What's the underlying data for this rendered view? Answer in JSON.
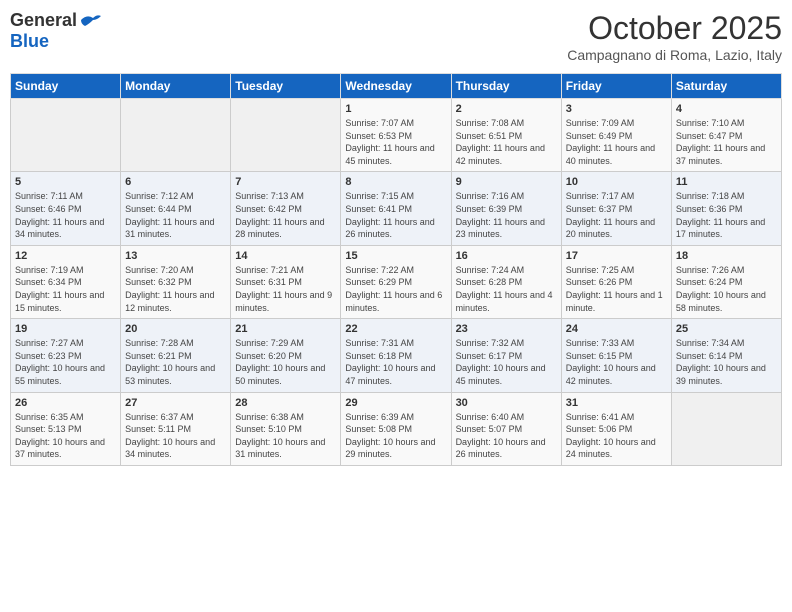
{
  "header": {
    "logo_general": "General",
    "logo_blue": "Blue",
    "month": "October 2025",
    "location": "Campagnano di Roma, Lazio, Italy"
  },
  "weekdays": [
    "Sunday",
    "Monday",
    "Tuesday",
    "Wednesday",
    "Thursday",
    "Friday",
    "Saturday"
  ],
  "weeks": [
    [
      {
        "day": "",
        "sunrise": "",
        "sunset": "",
        "daylight": ""
      },
      {
        "day": "",
        "sunrise": "",
        "sunset": "",
        "daylight": ""
      },
      {
        "day": "",
        "sunrise": "",
        "sunset": "",
        "daylight": ""
      },
      {
        "day": "1",
        "sunrise": "Sunrise: 7:07 AM",
        "sunset": "Sunset: 6:53 PM",
        "daylight": "Daylight: 11 hours and 45 minutes."
      },
      {
        "day": "2",
        "sunrise": "Sunrise: 7:08 AM",
        "sunset": "Sunset: 6:51 PM",
        "daylight": "Daylight: 11 hours and 42 minutes."
      },
      {
        "day": "3",
        "sunrise": "Sunrise: 7:09 AM",
        "sunset": "Sunset: 6:49 PM",
        "daylight": "Daylight: 11 hours and 40 minutes."
      },
      {
        "day": "4",
        "sunrise": "Sunrise: 7:10 AM",
        "sunset": "Sunset: 6:47 PM",
        "daylight": "Daylight: 11 hours and 37 minutes."
      }
    ],
    [
      {
        "day": "5",
        "sunrise": "Sunrise: 7:11 AM",
        "sunset": "Sunset: 6:46 PM",
        "daylight": "Daylight: 11 hours and 34 minutes."
      },
      {
        "day": "6",
        "sunrise": "Sunrise: 7:12 AM",
        "sunset": "Sunset: 6:44 PM",
        "daylight": "Daylight: 11 hours and 31 minutes."
      },
      {
        "day": "7",
        "sunrise": "Sunrise: 7:13 AM",
        "sunset": "Sunset: 6:42 PM",
        "daylight": "Daylight: 11 hours and 28 minutes."
      },
      {
        "day": "8",
        "sunrise": "Sunrise: 7:15 AM",
        "sunset": "Sunset: 6:41 PM",
        "daylight": "Daylight: 11 hours and 26 minutes."
      },
      {
        "day": "9",
        "sunrise": "Sunrise: 7:16 AM",
        "sunset": "Sunset: 6:39 PM",
        "daylight": "Daylight: 11 hours and 23 minutes."
      },
      {
        "day": "10",
        "sunrise": "Sunrise: 7:17 AM",
        "sunset": "Sunset: 6:37 PM",
        "daylight": "Daylight: 11 hours and 20 minutes."
      },
      {
        "day": "11",
        "sunrise": "Sunrise: 7:18 AM",
        "sunset": "Sunset: 6:36 PM",
        "daylight": "Daylight: 11 hours and 17 minutes."
      }
    ],
    [
      {
        "day": "12",
        "sunrise": "Sunrise: 7:19 AM",
        "sunset": "Sunset: 6:34 PM",
        "daylight": "Daylight: 11 hours and 15 minutes."
      },
      {
        "day": "13",
        "sunrise": "Sunrise: 7:20 AM",
        "sunset": "Sunset: 6:32 PM",
        "daylight": "Daylight: 11 hours and 12 minutes."
      },
      {
        "day": "14",
        "sunrise": "Sunrise: 7:21 AM",
        "sunset": "Sunset: 6:31 PM",
        "daylight": "Daylight: 11 hours and 9 minutes."
      },
      {
        "day": "15",
        "sunrise": "Sunrise: 7:22 AM",
        "sunset": "Sunset: 6:29 PM",
        "daylight": "Daylight: 11 hours and 6 minutes."
      },
      {
        "day": "16",
        "sunrise": "Sunrise: 7:24 AM",
        "sunset": "Sunset: 6:28 PM",
        "daylight": "Daylight: 11 hours and 4 minutes."
      },
      {
        "day": "17",
        "sunrise": "Sunrise: 7:25 AM",
        "sunset": "Sunset: 6:26 PM",
        "daylight": "Daylight: 11 hours and 1 minute."
      },
      {
        "day": "18",
        "sunrise": "Sunrise: 7:26 AM",
        "sunset": "Sunset: 6:24 PM",
        "daylight": "Daylight: 10 hours and 58 minutes."
      }
    ],
    [
      {
        "day": "19",
        "sunrise": "Sunrise: 7:27 AM",
        "sunset": "Sunset: 6:23 PM",
        "daylight": "Daylight: 10 hours and 55 minutes."
      },
      {
        "day": "20",
        "sunrise": "Sunrise: 7:28 AM",
        "sunset": "Sunset: 6:21 PM",
        "daylight": "Daylight: 10 hours and 53 minutes."
      },
      {
        "day": "21",
        "sunrise": "Sunrise: 7:29 AM",
        "sunset": "Sunset: 6:20 PM",
        "daylight": "Daylight: 10 hours and 50 minutes."
      },
      {
        "day": "22",
        "sunrise": "Sunrise: 7:31 AM",
        "sunset": "Sunset: 6:18 PM",
        "daylight": "Daylight: 10 hours and 47 minutes."
      },
      {
        "day": "23",
        "sunrise": "Sunrise: 7:32 AM",
        "sunset": "Sunset: 6:17 PM",
        "daylight": "Daylight: 10 hours and 45 minutes."
      },
      {
        "day": "24",
        "sunrise": "Sunrise: 7:33 AM",
        "sunset": "Sunset: 6:15 PM",
        "daylight": "Daylight: 10 hours and 42 minutes."
      },
      {
        "day": "25",
        "sunrise": "Sunrise: 7:34 AM",
        "sunset": "Sunset: 6:14 PM",
        "daylight": "Daylight: 10 hours and 39 minutes."
      }
    ],
    [
      {
        "day": "26",
        "sunrise": "Sunrise: 6:35 AM",
        "sunset": "Sunset: 5:13 PM",
        "daylight": "Daylight: 10 hours and 37 minutes."
      },
      {
        "day": "27",
        "sunrise": "Sunrise: 6:37 AM",
        "sunset": "Sunset: 5:11 PM",
        "daylight": "Daylight: 10 hours and 34 minutes."
      },
      {
        "day": "28",
        "sunrise": "Sunrise: 6:38 AM",
        "sunset": "Sunset: 5:10 PM",
        "daylight": "Daylight: 10 hours and 31 minutes."
      },
      {
        "day": "29",
        "sunrise": "Sunrise: 6:39 AM",
        "sunset": "Sunset: 5:08 PM",
        "daylight": "Daylight: 10 hours and 29 minutes."
      },
      {
        "day": "30",
        "sunrise": "Sunrise: 6:40 AM",
        "sunset": "Sunset: 5:07 PM",
        "daylight": "Daylight: 10 hours and 26 minutes."
      },
      {
        "day": "31",
        "sunrise": "Sunrise: 6:41 AM",
        "sunset": "Sunset: 5:06 PM",
        "daylight": "Daylight: 10 hours and 24 minutes."
      },
      {
        "day": "",
        "sunrise": "",
        "sunset": "",
        "daylight": ""
      }
    ]
  ]
}
